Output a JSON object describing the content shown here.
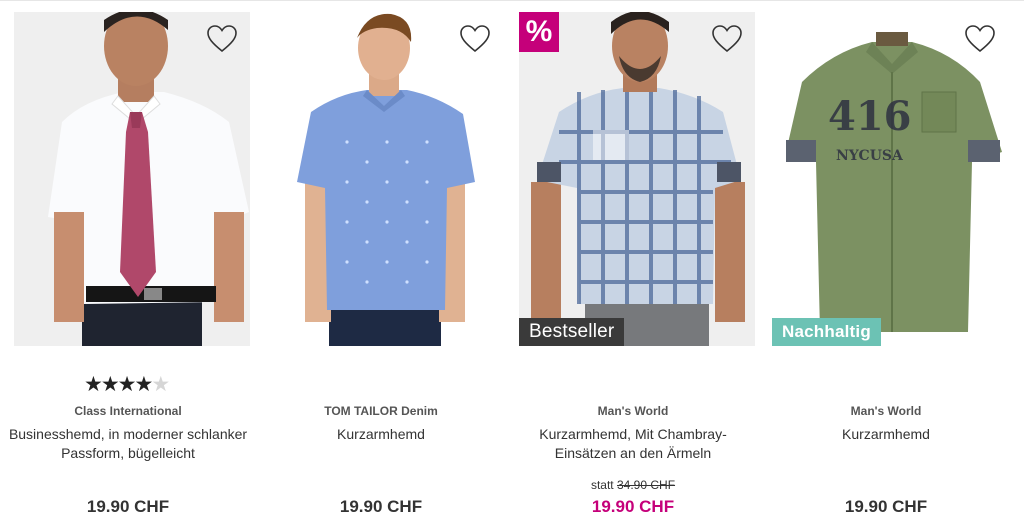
{
  "colors": {
    "sale": "#c5007a",
    "sustainable": "#6cc2b4",
    "bestseller": "#3a3a3a"
  },
  "products": [
    {
      "rating": "4.5 of 5",
      "brand": "Class International",
      "name_line1": "Businesshemd, in moderner schlanker",
      "name_line2": "Passform, bügelleicht",
      "price": "19.90 CHF"
    },
    {
      "brand": "TOM TAILOR Denim",
      "name_line1": "Kurzarmhemd",
      "price": "19.90 CHF"
    },
    {
      "sale_badge": "%",
      "label": "Bestseller",
      "brand": "Man's World",
      "name_line1": "Kurzarmhemd, Mit Chambray-",
      "name_line2": "Einsätzen an den Ärmeln",
      "old_price_prefix": "statt",
      "old_price": "34.90 CHF",
      "price": "19.90 CHF"
    },
    {
      "label": "Nachhaltig",
      "brand": "Man's World",
      "name_line1": "Kurzarmhemd",
      "price": "19.90 CHF"
    }
  ]
}
